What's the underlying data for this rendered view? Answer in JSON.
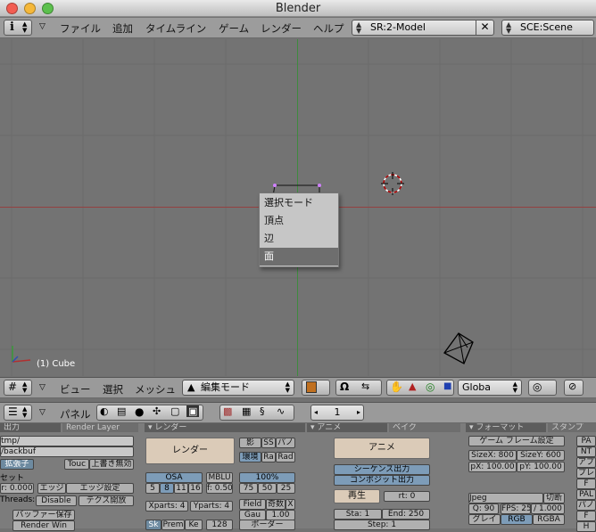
{
  "window": {
    "title": "Blender"
  },
  "menubar": {
    "items": [
      "ファイル",
      "追加",
      "タイムライン",
      "ゲーム",
      "レンダー",
      "ヘルプ"
    ],
    "screen": "SR:2-Model",
    "scene": "SCE:Scene",
    "close_glyph": "✕"
  },
  "viewport": {
    "status": "(1) Cube",
    "popup": {
      "title": "選択モード",
      "items": [
        "頂点",
        "辺",
        "面"
      ],
      "selected": "面"
    }
  },
  "view_header": {
    "menus": [
      "ビュー",
      "選択",
      "メッシュ"
    ],
    "mode": "編集モード",
    "orientation": "Globa"
  },
  "buttons_header": {
    "label": "パネル",
    "frame": "1"
  },
  "panels": {
    "output": {
      "tab1": "出力",
      "tab2": "Render Layer",
      "path1": "tmp/",
      "path2": "/backbuf",
      "ext": "拡張子",
      "touch": "Touc",
      "no_overwrite": "上書き無効",
      "set": "セット",
      "val": "r: 0.000",
      "edge": "エッジ",
      "edge_settings": "エッジ設定",
      "threads": "Threads:",
      "disable": "Disable",
      "tex_free": "テクス開放",
      "save_buffers": "バッファー保存",
      "render_win": "Render Win"
    },
    "render": {
      "tab": "レンダー",
      "render_btn": "レンダー",
      "shadow": "影",
      "ss": "SS",
      "pano": "パノ",
      "env": "環境",
      "ray": "Ra",
      "rad": "Rad",
      "osa": "OSA",
      "mblur": "MBLU",
      "percent": "100%",
      "osa_vals": [
        "5",
        "8",
        "11",
        "16"
      ],
      "blur_val": "f: 0.50",
      "pct_vals": [
        "75",
        "50",
        "25"
      ],
      "xparts": "Xparts: 4",
      "yparts": "Yparts: 4",
      "field": "Field",
      "odd": "奇数",
      "x": "X",
      "gau": "Gau",
      "gau_val": "1.00",
      "sky": "Sk",
      "premul": "Prem",
      "key": "Ke",
      "size128": "128",
      "border": "ボーダー"
    },
    "anim": {
      "tab1": "アニメ",
      "tab2": "ベイク",
      "anim_btn": "アニメ",
      "seq": "シーケンス出力",
      "comp": "コンポジット出力",
      "play": "再生",
      "rt": "rt: 0",
      "sta": "Sta: 1",
      "end": "End: 250",
      "step": "Step: 1"
    },
    "format": {
      "tab1": "フォーマット",
      "tab2": "スタンプ",
      "game_frame": "ゲーム フレーム設定",
      "sizex": "SizeX: 800",
      "sizey": "SizeY: 600",
      "px": "pX: 100.00",
      "py": "pY: 100.00",
      "format": "Jpeg",
      "crop": "切断",
      "q": "Q: 90",
      "fps": "FPS: 25",
      "fps_div": "/ 1.000",
      "bw": "グレイ",
      "rgb": "RGB",
      "rgba": "RGBA",
      "right": [
        "PA",
        "NT",
        "アプ",
        "プレ",
        "F",
        "PAL",
        "パノ",
        "F",
        "H"
      ]
    }
  }
}
